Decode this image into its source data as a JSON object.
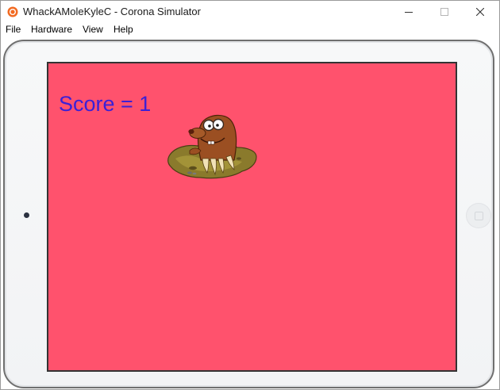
{
  "window": {
    "title": "WhackAMoleKyleC - Corona Simulator",
    "icon": "corona-app-icon",
    "controls": [
      "minimize-icon",
      "maximize-icon",
      "close-icon"
    ]
  },
  "menu": {
    "items": [
      {
        "label": "File"
      },
      {
        "label": "Hardware"
      },
      {
        "label": "View"
      },
      {
        "label": "Help"
      }
    ]
  },
  "game": {
    "score_text": "Score = 1",
    "background_color": "#ff526d",
    "score_color": "#3b20d6",
    "mole_icon": "mole-in-hole-sprite"
  }
}
